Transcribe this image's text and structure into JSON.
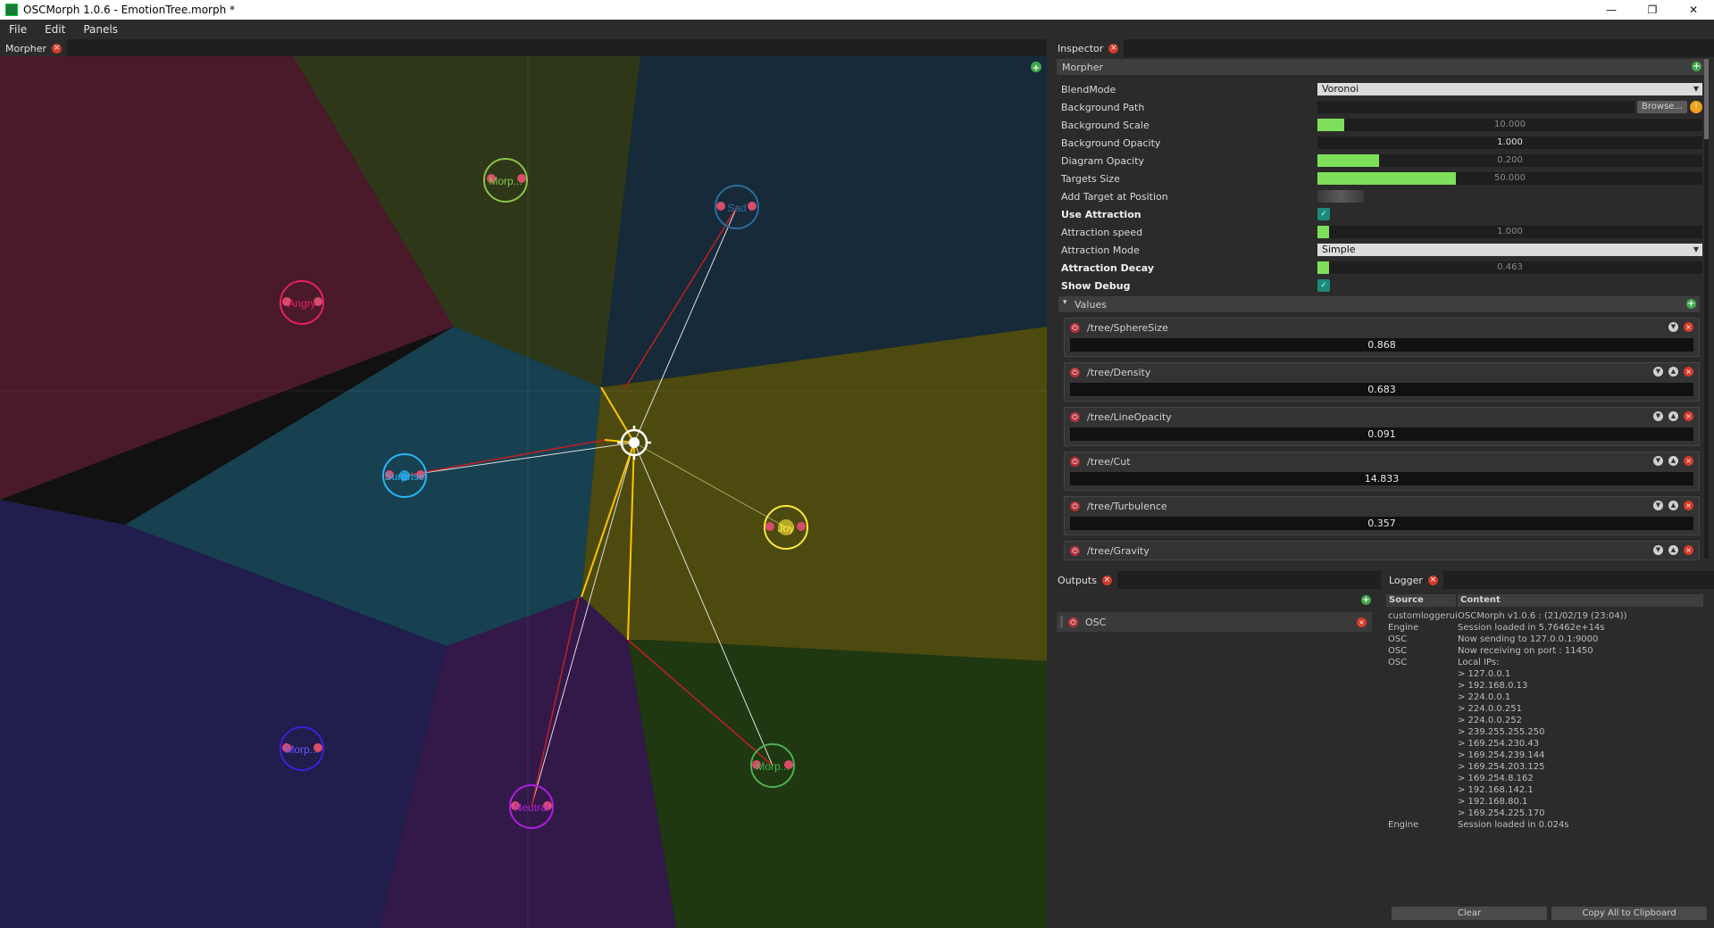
{
  "window": {
    "title": "OSCMorph 1.0.6 - EmotionTree.morph *",
    "minimize": "—",
    "maximize": "❐",
    "close": "✕"
  },
  "menu": [
    "File",
    "Edit",
    "Panels"
  ],
  "morpher_tab": {
    "label": "Morpher"
  },
  "canvas": {
    "regions": [
      {
        "name": "region-angry",
        "color": "#4a1a2a"
      },
      {
        "name": "region-top-middle",
        "color": "#2e3818"
      },
      {
        "name": "region-sad",
        "color": "#172a3a"
      },
      {
        "name": "region-surprise",
        "color": "#174050"
      },
      {
        "name": "region-joy",
        "color": "#4c4a0e"
      },
      {
        "name": "region-bottom-left",
        "color": "#211d4c"
      },
      {
        "name": "region-neutral",
        "color": "#33184a"
      },
      {
        "name": "region-bottom-right",
        "color": "#1f3812"
      }
    ],
    "targets": [
      {
        "label": "Morp...",
        "color": "#8bc34a"
      },
      {
        "label": "Sad",
        "color": "#2b6d9a"
      },
      {
        "label": "Angry",
        "color": "#e91e63"
      },
      {
        "label": "Surprise",
        "color": "#29b6f6"
      },
      {
        "label": "Joy",
        "color": "#ffeb3b"
      },
      {
        "label": "Morp...",
        "color": "#3f1fd9"
      },
      {
        "label": "Neutral",
        "color": "#b11fe0"
      },
      {
        "label": "Morp...",
        "color": "#4caf50"
      }
    ]
  },
  "inspector": {
    "tab_label": "Inspector",
    "section_title": "Morpher",
    "props": {
      "blendmode": {
        "label": "BlendMode",
        "value": "Voronoi"
      },
      "bg_path": {
        "label": "Background Path",
        "browse": "Browse..."
      },
      "bg_scale": {
        "label": "Background Scale",
        "value": "10.000",
        "fill": 0.07
      },
      "bg_opacity": {
        "label": "Background Opacity",
        "value": "1.000"
      },
      "diagram_opacity": {
        "label": "Diagram Opacity",
        "value": "0.200",
        "fill": 0.16
      },
      "targets_size": {
        "label": "Targets Size",
        "value": "50.000",
        "fill": 0.36
      },
      "add_target": {
        "label": "Add Target at Position"
      },
      "use_attraction": {
        "label": "Use Attraction"
      },
      "attraction_speed": {
        "label": "Attraction speed",
        "value": "1.000",
        "fill": 0.03
      },
      "attraction_mode": {
        "label": "Attraction Mode",
        "value": "Simple"
      },
      "attraction_decay": {
        "label": "Attraction Decay",
        "value": "0.463",
        "fill": 0.03
      },
      "show_debug": {
        "label": "Show Debug"
      }
    },
    "values_title": "Values",
    "values": [
      {
        "name": "/tree/SphereSize",
        "value": "0.868"
      },
      {
        "name": "/tree/Density",
        "value": "0.683"
      },
      {
        "name": "/tree/LineOpacity",
        "value": "0.091"
      },
      {
        "name": "/tree/Cut",
        "value": "14.833"
      },
      {
        "name": "/tree/Turbulence",
        "value": "0.357"
      },
      {
        "name": "/tree/Gravity",
        "value": ""
      }
    ]
  },
  "outputs": {
    "tab_label": "Outputs",
    "items": [
      {
        "label": "OSC"
      }
    ]
  },
  "logger": {
    "tab_label": "Logger",
    "columns": {
      "source": "Source",
      "content": "Content"
    },
    "rows": [
      {
        "source": "customloggerui",
        "content": "OSCMorph v1.0.6 : (21/02/19 (23:04))"
      },
      {
        "source": "Engine",
        "content": "Session loaded in 5.76462e+14s"
      },
      {
        "source": "OSC",
        "content": "Now sending to 127.0.0.1:9000"
      },
      {
        "source": "OSC",
        "content": "Now receiving on port : 11450"
      },
      {
        "source": "OSC",
        "content": "Local IPs:"
      },
      {
        "source": "",
        "content": "> 127.0.0.1"
      },
      {
        "source": "",
        "content": "> 192.168.0.13"
      },
      {
        "source": "",
        "content": "> 224.0.0.1"
      },
      {
        "source": "",
        "content": "> 224.0.0.251"
      },
      {
        "source": "",
        "content": "> 224.0.0.252"
      },
      {
        "source": "",
        "content": "> 239.255.255.250"
      },
      {
        "source": "",
        "content": "> 169.254.230.43"
      },
      {
        "source": "",
        "content": "> 169.254.239.144"
      },
      {
        "source": "",
        "content": "> 169.254.203.125"
      },
      {
        "source": "",
        "content": "> 169.254.8.162"
      },
      {
        "source": "",
        "content": "> 192.168.142.1"
      },
      {
        "source": "",
        "content": "> 192.168.80.1"
      },
      {
        "source": "",
        "content": "> 169.254.225.170"
      },
      {
        "source": "Engine",
        "content": "Session loaded in 0.024s"
      }
    ],
    "clear_label": "Clear",
    "copy_label": "Copy All to Clipboard"
  }
}
